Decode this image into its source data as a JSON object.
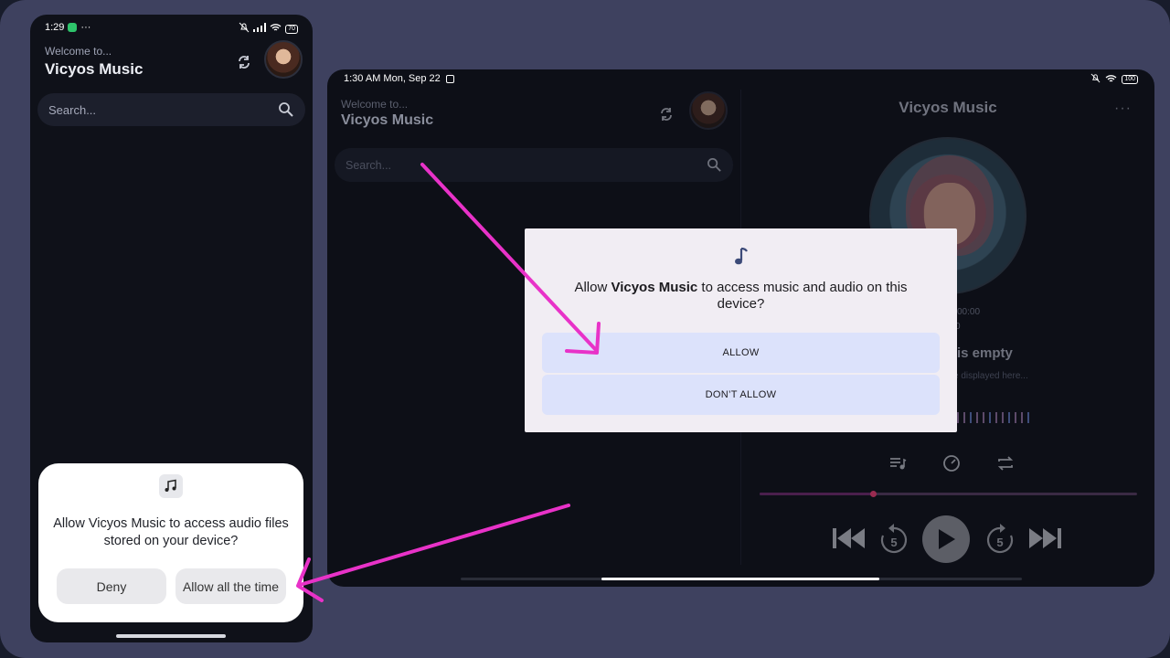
{
  "phone": {
    "status": {
      "time": "1:29",
      "dots": "···",
      "battery": "70"
    },
    "welcome": "Welcome to...",
    "title": "Vicyos Music",
    "search_placeholder": "Search...",
    "dialog": {
      "message": "Allow Vicyos Music to access audio files stored on your device?",
      "deny": "Deny",
      "allow": "Allow all the time"
    }
  },
  "tablet": {
    "status": {
      "time": "1:30 AM Mon, Sep 22",
      "battery": "100"
    },
    "welcome": "Welcome to...",
    "title": "Vicyos Music",
    "search_placeholder": "Search...",
    "player": {
      "title": "Vicyos Music",
      "more": "···",
      "time_a": "00:00",
      "time_b": "0",
      "queue_empty": "is empty",
      "queue_hint": "e displayed here...",
      "skip_seconds": "5",
      "progress": 0.3
    },
    "dialog": {
      "message_prefix": "Allow ",
      "app_name": "Vicyos Music",
      "message_suffix": " to access music and audio on this device?",
      "allow": "ALLOW",
      "deny": "DON’T ALLOW"
    }
  },
  "annotation": {
    "arrow_color": "#e832c8"
  },
  "icons": {
    "phone_status": [
      "messages-icon",
      "mute-icon",
      "signal-icon",
      "wifi-icon",
      "battery-icon"
    ],
    "tablet_status": [
      "mute-icon",
      "wifi-icon",
      "battery-icon"
    ]
  }
}
